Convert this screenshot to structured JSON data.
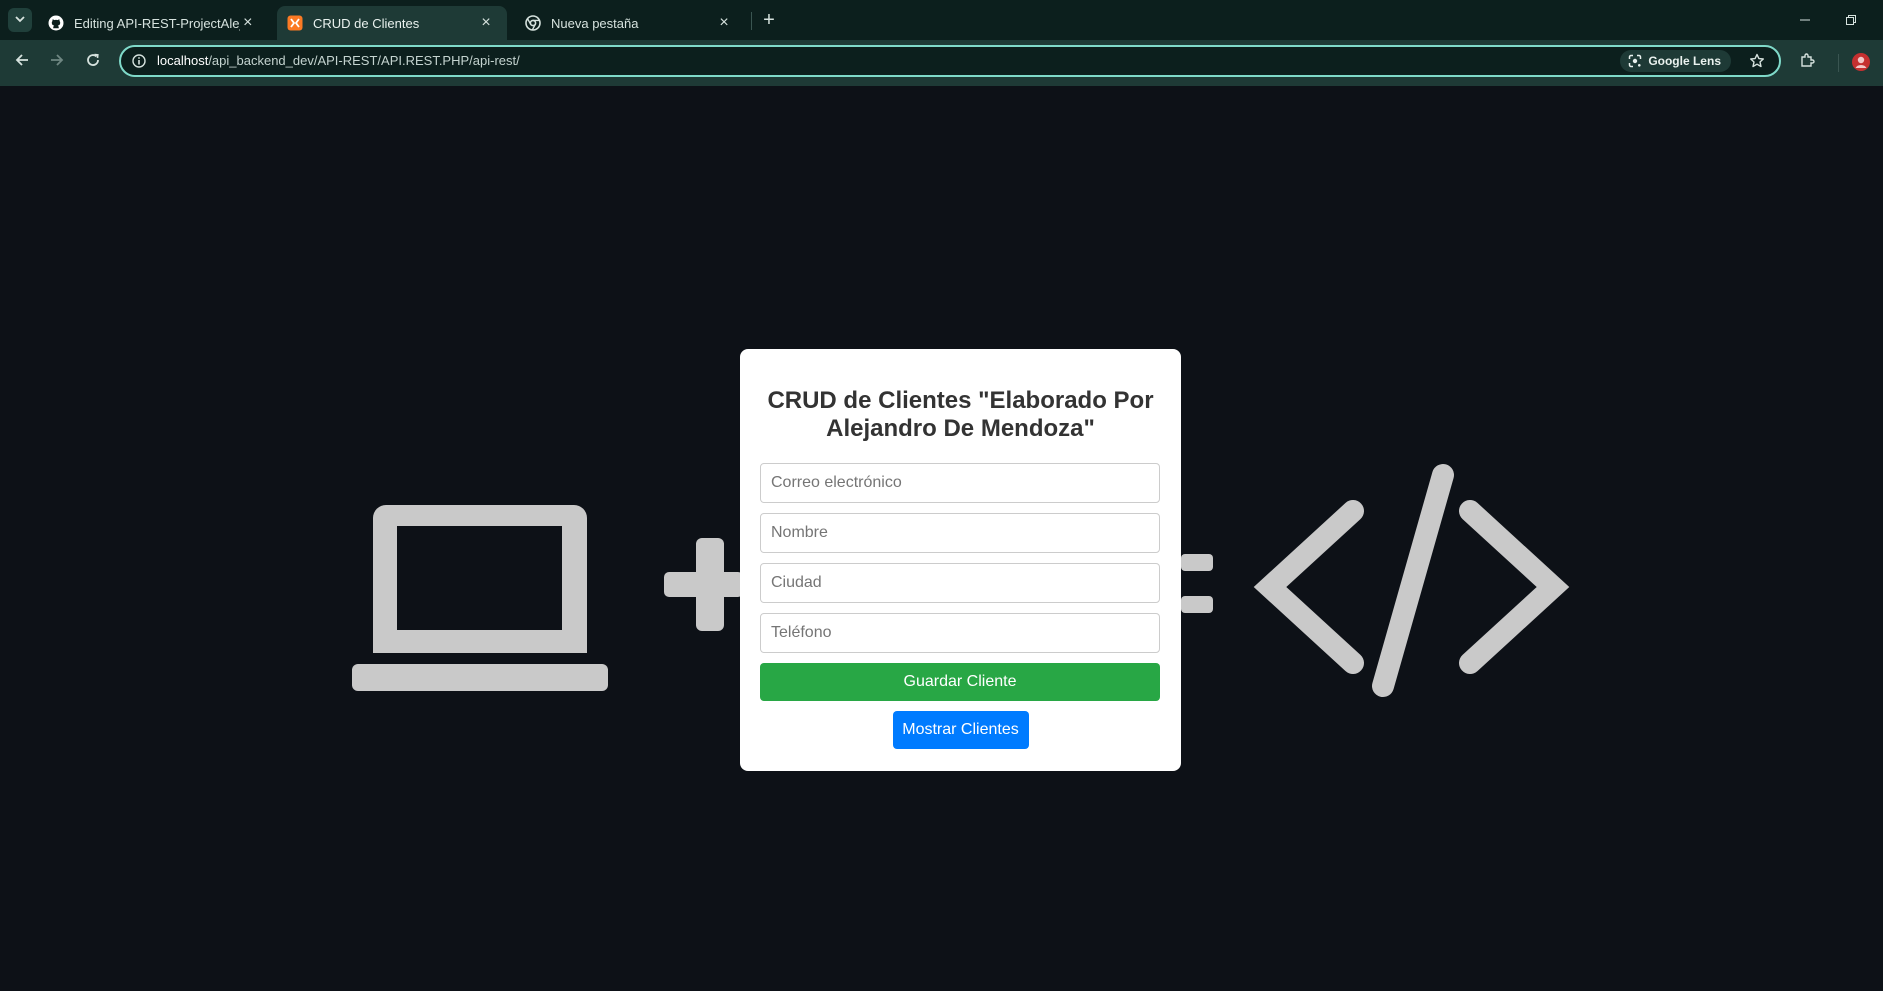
{
  "browser": {
    "tabs": [
      {
        "title": "Editing API-REST-ProjectAlejan",
        "icon": "github-icon",
        "active": false
      },
      {
        "title": "CRUD de Clientes",
        "icon": "xampp-icon",
        "active": true
      },
      {
        "title": "Nueva pestaña",
        "icon": "chrome-icon",
        "active": false
      }
    ],
    "url_host": "localhost",
    "url_path": "/api_backend_dev/API-REST/API.REST.PHP/api-rest/",
    "lens_label": "Google Lens"
  },
  "page": {
    "heading": "CRUD de Clientes \"Elaborado Por Alejandro De Mendoza\"",
    "fields": {
      "email_placeholder": "Correo electrónico",
      "name_placeholder": "Nombre",
      "city_placeholder": "Ciudad",
      "phone_placeholder": "Teléfono"
    },
    "save_button": "Guardar Cliente",
    "show_button": "Mostrar Clientes"
  },
  "colors": {
    "page_bg": "#0d1117",
    "save_button": "#28a745",
    "show_button": "#007bff",
    "background_art": "#c9c9c9"
  }
}
